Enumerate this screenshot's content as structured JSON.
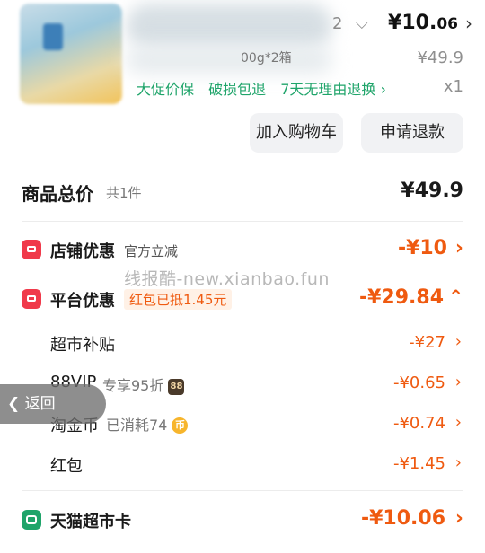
{
  "product": {
    "spec_partial": "00g*2箱",
    "spec_count": "2",
    "price_main": "¥10.",
    "price_decimal": "06",
    "original_price": "¥49.9",
    "quantity": "x1",
    "guarantees": [
      "大促价保",
      "破损包退",
      "7天无理由退换 ›"
    ]
  },
  "actions": {
    "add_cart": "加入购物车",
    "refund": "申请退款"
  },
  "total": {
    "label": "商品总价",
    "count": "共1件",
    "price": "¥49.9"
  },
  "store_discount": {
    "label": "店铺优惠",
    "note": "官方立减",
    "amount": "-¥10"
  },
  "platform_discount": {
    "label": "平台优惠",
    "tag": "红包已抵1.45元",
    "amount": "-¥29.84"
  },
  "sub_items": [
    {
      "label": "超市补贴",
      "note": "",
      "amount": "-¥27"
    },
    {
      "label": "88VIP",
      "note": "专享95折",
      "badge": "88",
      "amount": "-¥0.65"
    },
    {
      "label": "淘金币",
      "note": "已消耗74",
      "badge": "币",
      "amount": "-¥0.74"
    },
    {
      "label": "红包",
      "note": "",
      "amount": "-¥1.45"
    }
  ],
  "tmall_card": {
    "label": "天猫超市卡",
    "amount": "-¥10.06"
  },
  "watermark": "线报酷-new.xianbao.fun",
  "back": "返回",
  "icons": {
    "store": "shop-icon",
    "platform": "coupon-icon",
    "card": "card-icon"
  },
  "colors": {
    "accent": "#ef5a10",
    "green": "#1fa46a",
    "red": "#f03a4b"
  }
}
